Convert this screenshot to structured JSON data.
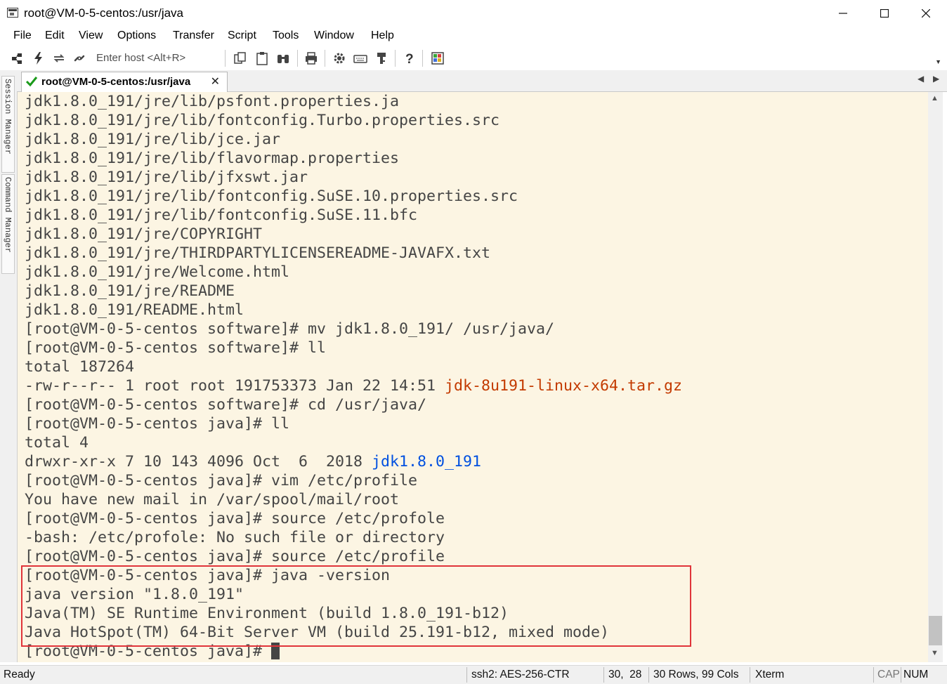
{
  "window": {
    "title": "root@VM-0-5-centos:/usr/java"
  },
  "menu": [
    "File",
    "Edit",
    "View",
    "Options",
    "Transfer",
    "Script",
    "Tools",
    "Window",
    "Help"
  ],
  "toolbar": {
    "host_placeholder": "Enter host <Alt+R>"
  },
  "sidebar": {
    "session_manager": "Session Manager",
    "command_manager": "Command Manager"
  },
  "tab": {
    "label": "root@VM-0-5-centos:/usr/java"
  },
  "terminal": {
    "lines": [
      "jdk1.8.0_191/jre/lib/psfont.properties.ja",
      "jdk1.8.0_191/jre/lib/fontconfig.Turbo.properties.src",
      "jdk1.8.0_191/jre/lib/jce.jar",
      "jdk1.8.0_191/jre/lib/flavormap.properties",
      "jdk1.8.0_191/jre/lib/jfxswt.jar",
      "jdk1.8.0_191/jre/lib/fontconfig.SuSE.10.properties.src",
      "jdk1.8.0_191/jre/lib/fontconfig.SuSE.11.bfc",
      "jdk1.8.0_191/jre/COPYRIGHT",
      "jdk1.8.0_191/jre/THIRDPARTYLICENSEREADME-JAVAFX.txt",
      "jdk1.8.0_191/jre/Welcome.html",
      "jdk1.8.0_191/jre/README",
      "jdk1.8.0_191/README.html",
      "[root@VM-0-5-centos software]# mv jdk1.8.0_191/ /usr/java/",
      "[root@VM-0-5-centos software]# ll",
      "total 187264",
      "-rw-r--r-- 1 root root 191753373 Jan 22 14:51 ",
      "[root@VM-0-5-centos software]# cd /usr/java/",
      "[root@VM-0-5-centos java]# ll",
      "total 4",
      "drwxr-xr-x 7 10 143 4096 Oct  6  2018 ",
      "[root@VM-0-5-centos java]# vim /etc/profile",
      "You have new mail in /var/spool/mail/root",
      "[root@VM-0-5-centos java]# source /etc/profole",
      "-bash: /etc/profole: No such file or directory",
      "[root@VM-0-5-centos java]# source /etc/profile",
      "[root@VM-0-5-centos java]# java -version",
      "java version \"1.8.0_191\"",
      "Java(TM) SE Runtime Environment (build 1.8.0_191-b12)",
      "Java HotSpot(TM) 64-Bit Server VM (build 25.191-b12, mixed mode)",
      "[root@VM-0-5-centos java]# "
    ],
    "archive_file": "jdk-8u191-linux-x64.tar.gz",
    "dir_name": "jdk1.8.0_191",
    "colors": {
      "background": "#fcf5e3",
      "text": "#454545",
      "archive": "#c33a00",
      "directory": "#0050e0",
      "highlight_box": "#e0343a"
    }
  },
  "status": {
    "ready": "Ready",
    "cipher": "ssh2: AES-256-CTR",
    "position": "30,  28",
    "size": "30 Rows, 99 Cols",
    "term_type": "Xterm",
    "caps": "CAP",
    "num": "NUM"
  }
}
